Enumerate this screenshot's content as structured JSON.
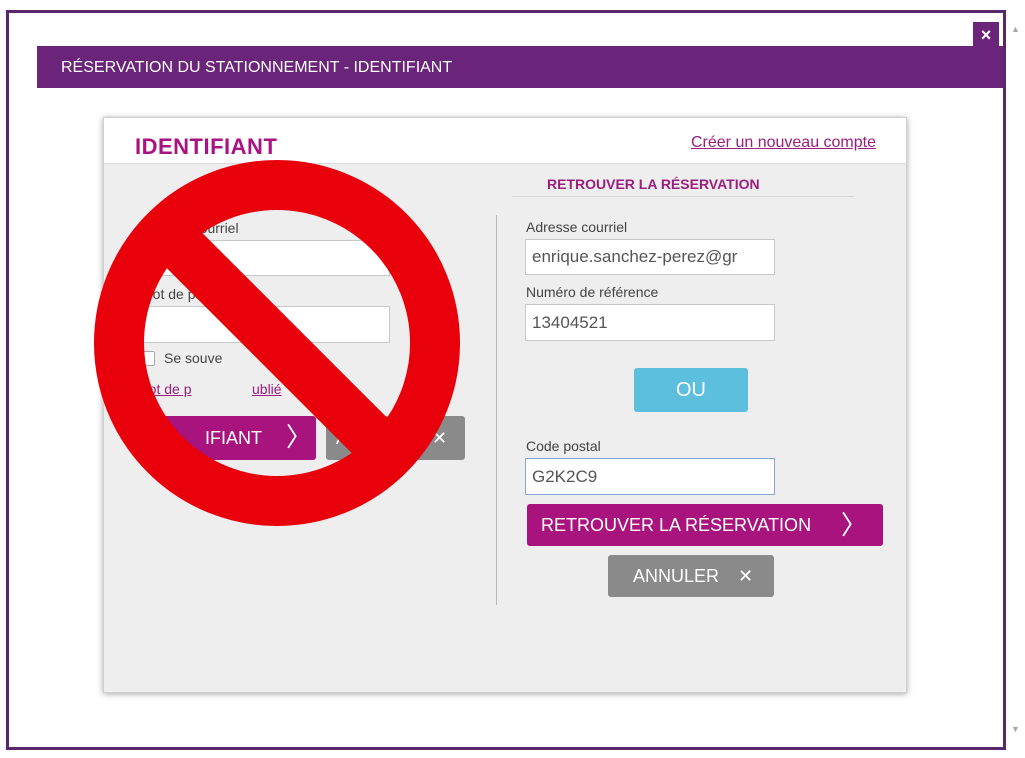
{
  "dialog": {
    "close_label": "×",
    "title": "RÉSERVATION DU STATIONNEMENT - IDENTIFIANT"
  },
  "scrollbar": {
    "up": "▲",
    "down": "▼"
  },
  "login": {
    "heading": "IDENTIFIANT",
    "create_account_link": "Créer un nouveau compte",
    "email_label": "se courriel",
    "email_value": "",
    "password_label": "Mot de passe",
    "password_value": "",
    "remember_label": "Se souve",
    "remember_label_end": "moi",
    "forgot_link": "Mot de p",
    "forgot_link_end": "ublié",
    "submit_label": "IFIANT",
    "submit_icon": "〉",
    "cancel_label": "ANNU",
    "cancel_icon": "✕"
  },
  "find": {
    "heading": "RETROUVER LA RÉSERVATION",
    "email_label": "Adresse courriel",
    "email_value": "enrique.sanchez-perez@gr",
    "reference_label": "Numéro de référence",
    "reference_value": "13404521",
    "or_label": "OU",
    "postal_label": "Code postal",
    "postal_value": "G2K2C9",
    "submit_label": "RETROUVER LA RÉSERVATION",
    "submit_icon": "〉",
    "cancel_label": "ANNULER",
    "cancel_icon": "✕"
  },
  "colors": {
    "brand_purple": "#6a2479",
    "accent_magenta": "#a8137e",
    "button_grey": "#8a8a8a",
    "button_blue": "#5cbfdd",
    "prohibition_red": "#e8000b"
  },
  "overlay": {
    "icon": "prohibition-sign"
  }
}
